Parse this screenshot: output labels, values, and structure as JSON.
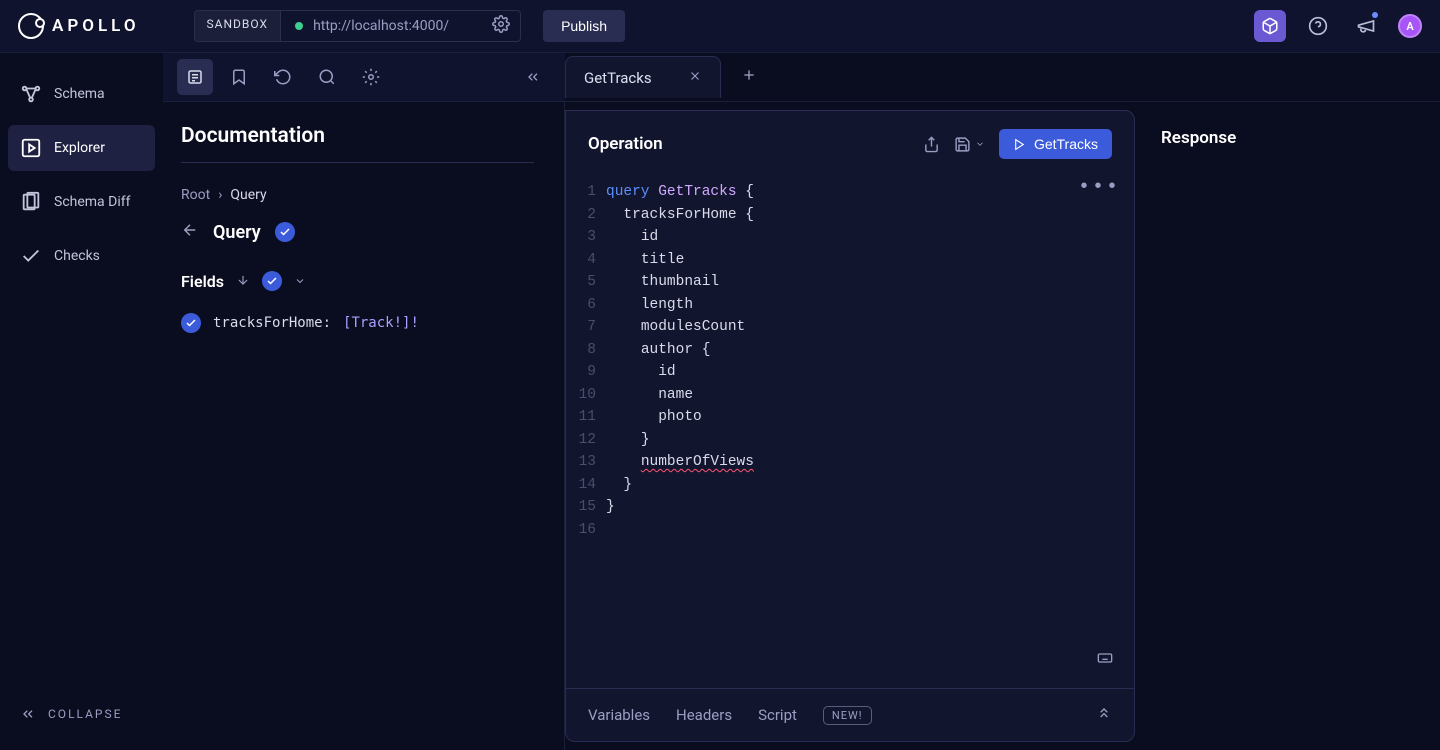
{
  "header": {
    "logo_text": "APOLLO",
    "sandbox_label": "SANDBOX",
    "url": "http://localhost:4000/",
    "publish_label": "Publish"
  },
  "sidebar": {
    "items": [
      {
        "label": "Schema"
      },
      {
        "label": "Explorer"
      },
      {
        "label": "Schema Diff"
      },
      {
        "label": "Checks"
      }
    ],
    "collapse_label": "COLLAPSE"
  },
  "docs": {
    "title": "Documentation",
    "breadcrumb_root": "Root",
    "breadcrumb_current": "Query",
    "type_name": "Query",
    "fields_label": "Fields",
    "field": {
      "name": "tracksForHome:",
      "type": "[Track!]!"
    }
  },
  "operation": {
    "tab_label": "GetTracks",
    "panel_title": "Operation",
    "run_label": "GetTracks",
    "code_lines": [
      {
        "n": "1",
        "indent": "",
        "tokens": [
          [
            "kw",
            "query "
          ],
          [
            "opname",
            "GetTracks"
          ],
          [
            "plain",
            " {"
          ]
        ]
      },
      {
        "n": "2",
        "indent": "  ",
        "tokens": [
          [
            "plain",
            "tracksForHome {"
          ]
        ]
      },
      {
        "n": "3",
        "indent": "    ",
        "tokens": [
          [
            "plain",
            "id"
          ]
        ]
      },
      {
        "n": "4",
        "indent": "    ",
        "tokens": [
          [
            "plain",
            "title"
          ]
        ]
      },
      {
        "n": "5",
        "indent": "    ",
        "tokens": [
          [
            "plain",
            "thumbnail"
          ]
        ]
      },
      {
        "n": "6",
        "indent": "    ",
        "tokens": [
          [
            "plain",
            "length"
          ]
        ]
      },
      {
        "n": "7",
        "indent": "    ",
        "tokens": [
          [
            "plain",
            "modulesCount"
          ]
        ]
      },
      {
        "n": "8",
        "indent": "    ",
        "tokens": [
          [
            "plain",
            "author {"
          ]
        ]
      },
      {
        "n": "9",
        "indent": "      ",
        "tokens": [
          [
            "plain",
            "id"
          ]
        ]
      },
      {
        "n": "10",
        "indent": "      ",
        "tokens": [
          [
            "plain",
            "name"
          ]
        ]
      },
      {
        "n": "11",
        "indent": "      ",
        "tokens": [
          [
            "plain",
            "photo"
          ]
        ]
      },
      {
        "n": "12",
        "indent": "    ",
        "tokens": [
          [
            "plain",
            "}"
          ]
        ]
      },
      {
        "n": "13",
        "indent": "    ",
        "tokens": [
          [
            "error",
            "numberOfViews"
          ]
        ]
      },
      {
        "n": "14",
        "indent": "  ",
        "tokens": [
          [
            "plain",
            "}"
          ]
        ]
      },
      {
        "n": "15",
        "indent": "",
        "tokens": [
          [
            "plain",
            "}"
          ]
        ]
      },
      {
        "n": "16",
        "indent": "",
        "tokens": []
      }
    ],
    "bottom_tabs": {
      "variables": "Variables",
      "headers": "Headers",
      "script": "Script",
      "new_badge": "NEW!"
    }
  },
  "response": {
    "title": "Response"
  }
}
